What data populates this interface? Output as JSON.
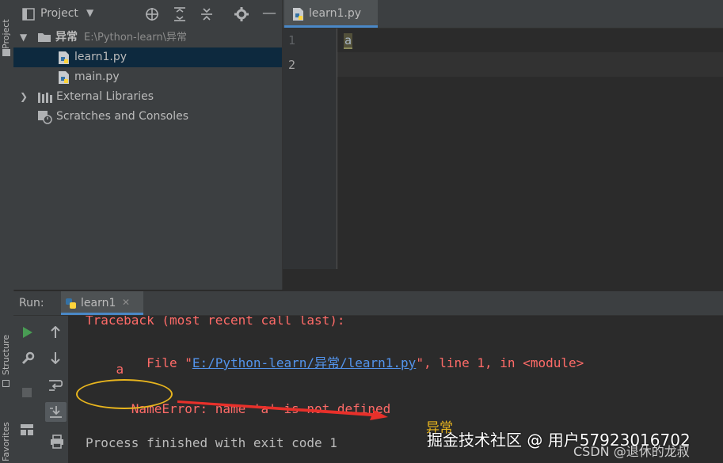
{
  "sidebar": {
    "project_tab": "Project",
    "structure_tab": "Structure",
    "favorites_tab": "Favorites"
  },
  "project_panel": {
    "title": "Project",
    "root_name": "异常",
    "root_path": "E:\\Python-learn\\异常",
    "files": [
      "learn1.py",
      "main.py"
    ],
    "external_libraries": "External Libraries",
    "scratches": "Scratches and Consoles"
  },
  "editor": {
    "tab_label": "learn1.py",
    "line_numbers": [
      "1",
      "2"
    ],
    "lines": [
      "a",
      ""
    ]
  },
  "run": {
    "label": "Run:",
    "tab_label": "learn1",
    "output": {
      "traceback": "Traceback (most recent call last):",
      "file_prefix": "  File \"",
      "file_link": "E:/Python-learn/异常/learn1.py",
      "file_suffix": "\", line 1, in <module>",
      "code_line": "    a",
      "error_name": "NameError:",
      "error_msg": " name 'a' is not defined",
      "finish": "Process finished with exit code 1"
    }
  },
  "annotation": {
    "label": "异常"
  },
  "watermark": {
    "main": "掘金技术社区 @ 用户57923016702",
    "sub": "CSDN @退休的龙叔"
  },
  "colors": {
    "error": "#ff6b68",
    "link": "#5394ec",
    "highlight": "#e8b51e",
    "arrow": "#e8302a",
    "selection": "#0d293e"
  }
}
